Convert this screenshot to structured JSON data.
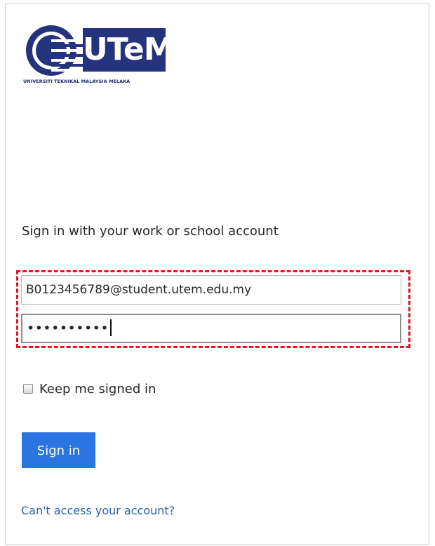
{
  "logo": {
    "wordmark": "UTeM",
    "caption": "UNIVERSITI TEKNIKAL MALAYSIA MELAKA",
    "ring_text": "UNIVERSITI TEKNIKAL MALAYSIA MELAKA",
    "brand_color": "#25327d"
  },
  "signin": {
    "heading": "Sign in with your work or school account",
    "email_value": "B0123456789@student.utem.edu.my",
    "password_mask": "••••••••••",
    "keep_signed_in_label": "Keep me signed in",
    "keep_signed_in_checked": false,
    "button_label": "Sign in",
    "help_link": "Can't access your account?"
  },
  "colors": {
    "button": "#2b75e3",
    "link": "#2a63a8",
    "highlight": "#e0191f"
  }
}
